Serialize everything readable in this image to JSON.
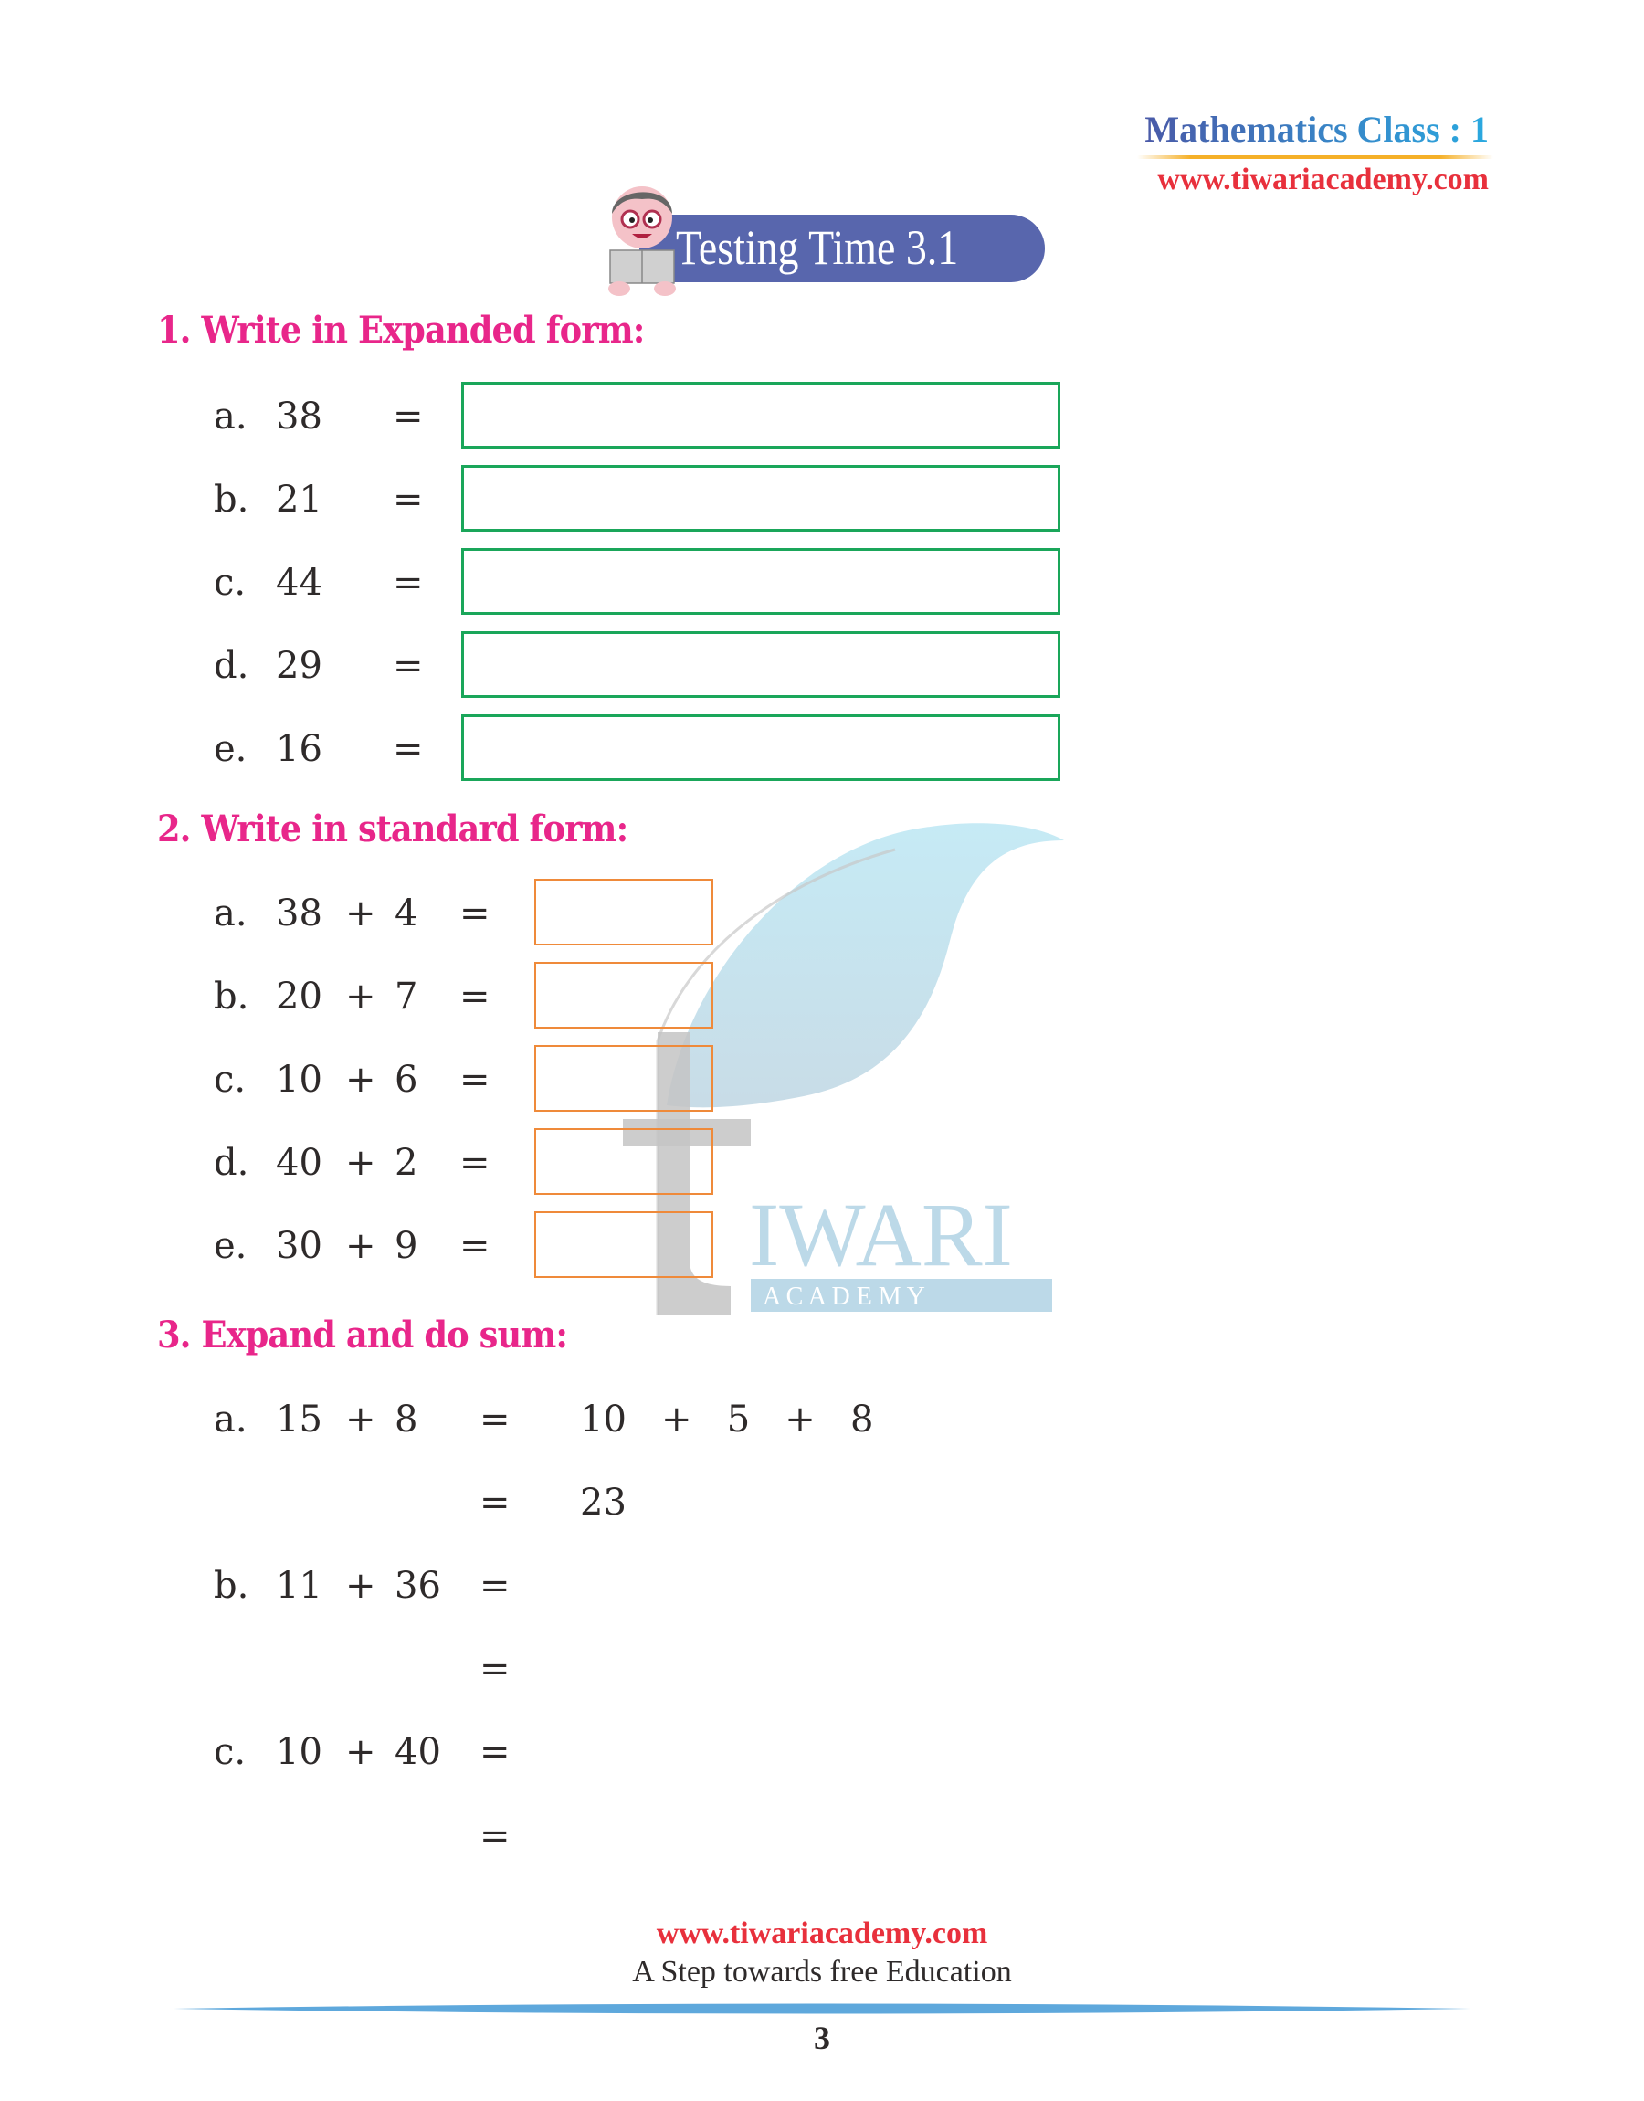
{
  "header": {
    "title": "Mathematics Class : 1",
    "url": "www.tiwariacademy.com"
  },
  "banner": {
    "title": "Testing Time 3.1",
    "mascot_icon": "reading-boy-icon"
  },
  "sections": [
    {
      "heading": "1.  Write in Expanded form:",
      "items": [
        {
          "label": "a.",
          "expr": "38",
          "eq": "=",
          "answer": ""
        },
        {
          "label": "b.",
          "expr": "21",
          "eq": "=",
          "answer": ""
        },
        {
          "label": "c.",
          "expr": "44",
          "eq": "=",
          "answer": ""
        },
        {
          "label": "d.",
          "expr": "29",
          "eq": "=",
          "answer": ""
        },
        {
          "label": "e.",
          "expr": "16",
          "eq": "=",
          "answer": ""
        }
      ]
    },
    {
      "heading": "2.  Write in standard form:",
      "items": [
        {
          "label": "a.",
          "a": "38",
          "op": "+",
          "b": "4",
          "eq": "=",
          "answer": ""
        },
        {
          "label": "b.",
          "a": "20",
          "op": "+",
          "b": "7",
          "eq": "=",
          "answer": ""
        },
        {
          "label": "c.",
          "a": "10",
          "op": "+",
          "b": "6",
          "eq": "=",
          "answer": ""
        },
        {
          "label": "d.",
          "a": "40",
          "op": "+",
          "b": "2",
          "eq": "=",
          "answer": ""
        },
        {
          "label": "e.",
          "a": "30",
          "op": "+",
          "b": "9",
          "eq": "=",
          "answer": ""
        }
      ]
    },
    {
      "heading": "3.  Expand and do sum:",
      "items": [
        {
          "label": "a.",
          "a": "15",
          "op": "+",
          "b": "8",
          "eq": "=",
          "line1": "10   +   5   +   8",
          "eq2": "=",
          "line2": "23"
        },
        {
          "label": "b.",
          "a": "11",
          "op": "+",
          "b": "36",
          "eq": "=",
          "line1": "",
          "eq2": "=",
          "line2": ""
        },
        {
          "label": "c.",
          "a": "10",
          "op": "+",
          "b": "40",
          "eq": "=",
          "line1": "",
          "eq2": "=",
          "line2": ""
        }
      ]
    }
  ],
  "watermark": {
    "brand": "IWARI",
    "sub": "A C A D E M Y",
    "logo_icon": "tiwari-leaf-logo-icon"
  },
  "footer": {
    "url": "www.tiwariacademy.com",
    "tagline": "A Step towards free Education",
    "page_number": "3"
  },
  "colors": {
    "heading": "#e8268a",
    "banner": "#5866ad",
    "green_box": "#1aa65a",
    "orange_box": "#ef8a3a",
    "url_red": "#e8303c",
    "footer_line": "#5ea8dc"
  }
}
